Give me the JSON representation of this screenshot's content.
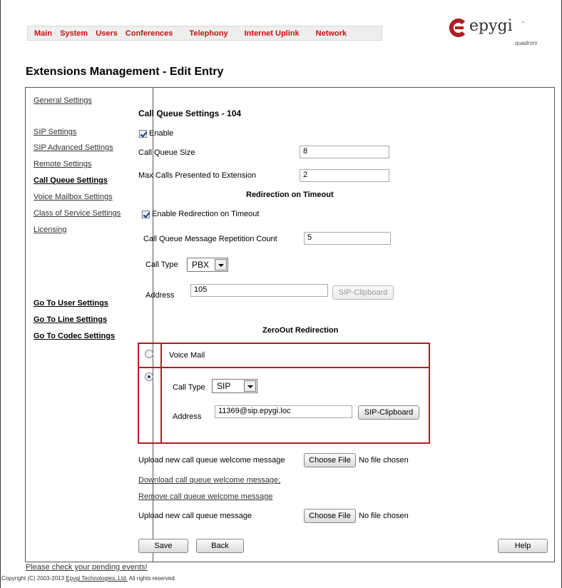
{
  "nav": {
    "items": [
      "Main",
      "System",
      "Users",
      "Conferences",
      "Telephony",
      "Internet Uplink",
      "Network"
    ]
  },
  "logo": {
    "brand": "epygi",
    "sub": "quadrom"
  },
  "page_title": "Extensions Management - Edit Entry",
  "sidebar": {
    "items": [
      "General Settings",
      "SIP Settings",
      "SIP Advanced Settings",
      "Remote Settings",
      "Call Queue Settings",
      "Voice Mailbox Settings",
      "Class of Service Settings",
      "Licensing"
    ],
    "goto": [
      "Go To User Settings",
      "Go To Line Settings",
      "Go To Codec Settings"
    ]
  },
  "form": {
    "section_title": "Call Queue Settings - 104",
    "enable_label": "Enable",
    "queue_size_label": "Call Queue Size",
    "queue_size_value": "8",
    "max_calls_label": "Max Calls Presented to Extension",
    "max_calls_value": "2",
    "redirection_heading": "Redirection on Timeout",
    "enable_redirection_label": "Enable Redirection on Timeout",
    "repetition_label": "Call Queue Message Repetition Count",
    "repetition_value": "5",
    "call_type_label": "Call Type",
    "call_type_value": "PBX",
    "address_label": "Address",
    "address_value": "105",
    "clipboard_label": "SIP-Clipboard",
    "zeroout_heading": "ZeroOut Redirection",
    "voicemail_label": "Voice Mail",
    "zero_call_type_label": "Call Type",
    "zero_call_type_value": "SIP",
    "zero_address_label": "Address",
    "zero_address_value": "11369@sip.epygi.loc",
    "zero_clipboard_label": "SIP-Clipboard",
    "upload_welcome_label": "Upload new call queue welcome message",
    "choose_file_label": "Choose File",
    "no_file_label": "No file chosen",
    "download_welcome_label": "Download call queue welcome message;",
    "remove_welcome_label": "Remove call queue welcome message",
    "upload_message_label": "Upload new call queue message",
    "choose_file2_label": "Choose File",
    "no_file2_label": "No file chosen",
    "save_label": "Save",
    "back_label": "Back",
    "help_label": "Help"
  },
  "footer": {
    "pending": "Please check your pending events!",
    "copyright_pre": "Copyright (C) 2003-2013",
    "copyright_link": "Epygi Technologies, Ltd.",
    "copyright_post": "All rights reserved."
  },
  "colors": {
    "accent_red": "#cc1111",
    "box_red": "#b01e23"
  }
}
